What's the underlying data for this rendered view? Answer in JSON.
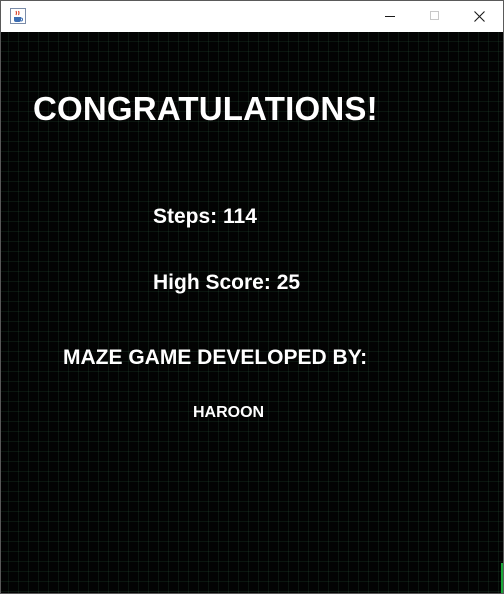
{
  "window": {
    "icon": "java-coffee-cup-icon",
    "controls": {
      "minimize_icon": "minimize-icon",
      "maximize_icon": "maximize-icon",
      "close_icon": "close-icon"
    }
  },
  "game": {
    "title": "CONGRATULATIONS!",
    "steps_label": "Steps:",
    "steps_value": "114",
    "high_score_label": "High Score:",
    "high_score_value": "25",
    "developed_by": "MAZE GAME DEVELOPED BY:",
    "author": "HAROON"
  },
  "colors": {
    "background": "#030303",
    "grid": "#1e4a2e",
    "text": "#ffffff",
    "edge_accent": "#1aa83a"
  }
}
